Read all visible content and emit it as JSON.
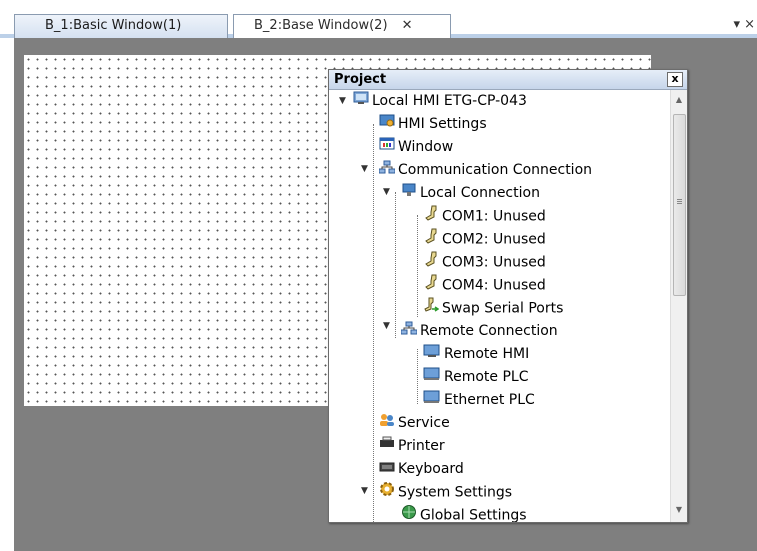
{
  "tabs": [
    {
      "label": "B_1:Basic Window(1)"
    },
    {
      "label": "B_2:Base Window(2)",
      "close_glyph": "✕"
    }
  ],
  "tab_menu_glyph": "▾ ×",
  "panel": {
    "title": "Project",
    "close_glyph": "x"
  },
  "tree": [
    {
      "label": "Local HMI ETG-CP-043",
      "icon": "monitor-icon",
      "expanded": true
    },
    {
      "label": "HMI Settings",
      "icon": "hmi-settings-icon"
    },
    {
      "label": "Window",
      "icon": "window-icon"
    },
    {
      "label": "Communication Connection",
      "icon": "network-icon",
      "expanded": true
    },
    {
      "label": "Local Connection",
      "icon": "local-connection-icon",
      "expanded": true
    },
    {
      "label": "COM1: Unused",
      "icon": "serial-port-icon"
    },
    {
      "label": "COM2: Unused",
      "icon": "serial-port-icon"
    },
    {
      "label": "COM3: Unused",
      "icon": "serial-port-icon"
    },
    {
      "label": "COM4: Unused",
      "icon": "serial-port-icon"
    },
    {
      "label": "Swap Serial Ports",
      "icon": "swap-ports-icon"
    },
    {
      "label": "Remote Connection",
      "icon": "network-icon",
      "expanded": true
    },
    {
      "label": "Remote HMI",
      "icon": "remote-monitor-icon"
    },
    {
      "label": "Remote PLC",
      "icon": "remote-plc-icon"
    },
    {
      "label": "Ethernet PLC",
      "icon": "ethernet-plc-icon"
    },
    {
      "label": "Service",
      "icon": "service-icon"
    },
    {
      "label": "Printer",
      "icon": "printer-icon"
    },
    {
      "label": "Keyboard",
      "icon": "keyboard-icon"
    },
    {
      "label": "System Settings",
      "icon": "gear-icon",
      "expanded": true
    },
    {
      "label": "Global Settings",
      "icon": "globe-icon"
    }
  ],
  "colors": {
    "workspace": "#7f7f7f",
    "panel_header": "#c6d5ea",
    "tab_active": "#ffffff"
  }
}
